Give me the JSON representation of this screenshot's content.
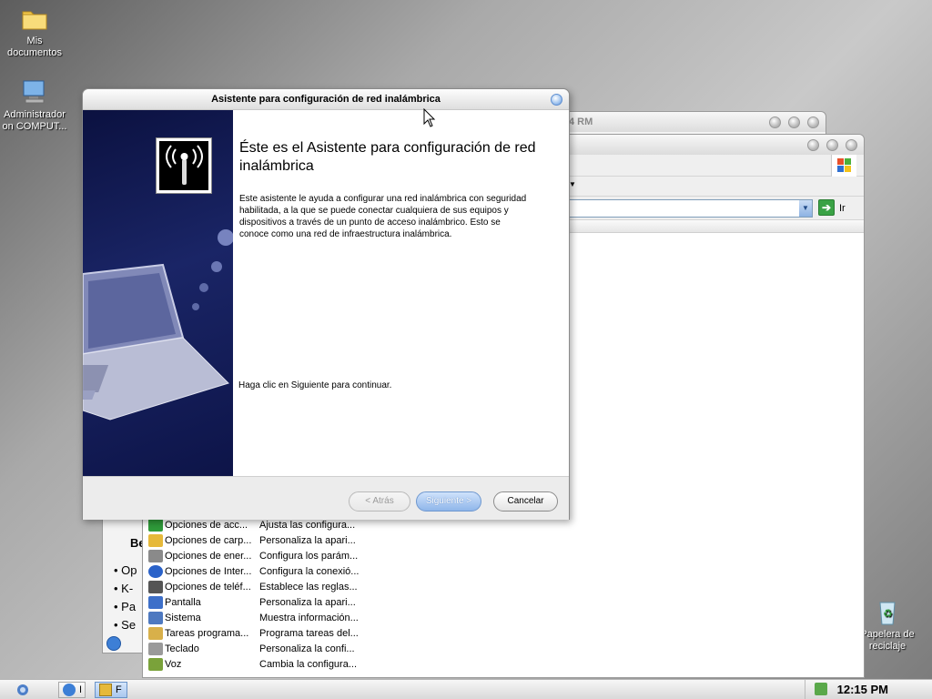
{
  "desktop": {
    "icons": [
      {
        "label": "Mis documentos",
        "icon": "folder-icon"
      },
      {
        "label": "Administrador on COMPUT...",
        "icon": "computer-icon"
      },
      {
        "label": "Papelera de reciclaje",
        "icon": "recycle-bin-icon"
      }
    ]
  },
  "back_window": {
    "title_fragment": "4 RM",
    "sidebar_heading": "Be",
    "bullets": [
      "Op",
      "K-",
      "Pa",
      "Se"
    ]
  },
  "control_panel": {
    "go_label": "Ir",
    "items": [
      {
        "name": "Opciones de acc...",
        "desc": "Ajusta las configura...",
        "color": "#2f9b3a"
      },
      {
        "name": "Opciones de carp...",
        "desc": "Personaliza la apari...",
        "color": "#e6b93a"
      },
      {
        "name": "Opciones de ener...",
        "desc": "Configura los parám...",
        "color": "#8a8a8a"
      },
      {
        "name": "Opciones de Inter...",
        "desc": "Configura la conexió...",
        "color": "#2a62c9"
      },
      {
        "name": "Opciones de teléf...",
        "desc": "Establece las reglas...",
        "color": "#555555"
      },
      {
        "name": "Pantalla",
        "desc": "Personaliza la apari...",
        "color": "#3d6fc9"
      },
      {
        "name": "Sistema",
        "desc": "Muestra información...",
        "color": "#4e79c0"
      },
      {
        "name": "Tareas programa...",
        "desc": "Programa tareas del...",
        "color": "#d8b04a"
      },
      {
        "name": "Teclado",
        "desc": "Personaliza la confi...",
        "color": "#9a9a9a"
      },
      {
        "name": "Voz",
        "desc": "Cambia la configura...",
        "color": "#7aa23a"
      }
    ]
  },
  "wizard": {
    "title": "Asistente para configuración de red inalámbrica",
    "heading": "Éste es el Asistente para configuración de red inalámbrica",
    "body": "Este asistente le ayuda a configurar una red inalámbrica con seguridad habilitada, a la que se puede conectar cualquiera de sus equipos y dispositivos a través de un punto de acceso inalámbrico. Esto se conoce como una red de infraestructura inalámbrica.",
    "continue_text": "Haga clic en Siguiente para continuar.",
    "back_label": "< Atrás",
    "next_label": "Siguiente >",
    "cancel_label": "Cancelar"
  },
  "taskbar": {
    "tasks": [
      {
        "label": "I",
        "active": false
      },
      {
        "label": "F",
        "active": true
      }
    ],
    "clock": "12:15 PM"
  }
}
